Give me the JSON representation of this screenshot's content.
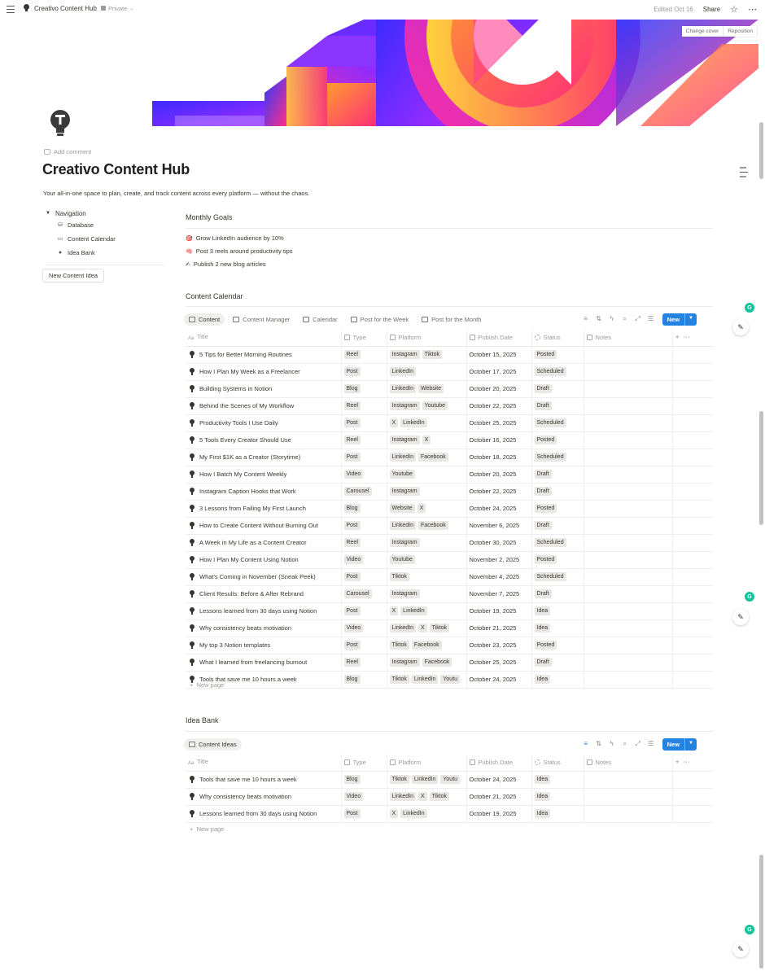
{
  "topbar": {
    "page_title": "Creativo Content Hub",
    "privacy": "Private",
    "edited": "Edited Oct 16",
    "share": "Share"
  },
  "cover": {
    "change_cover": "Change cover",
    "reposition": "Reposition",
    "colors": [
      "#4b2bff",
      "#9b27ff",
      "#ff2d6b",
      "#ffb02e",
      "#ff4fa3"
    ]
  },
  "page": {
    "add_comment": "Add comment",
    "title": "Creativo Content Hub",
    "subtitle": "Your all-in-one space to plan, create, and track content across every platform — without the chaos."
  },
  "nav": {
    "heading": "Navigation",
    "items": [
      {
        "label": "Database",
        "icon": "database-icon"
      },
      {
        "label": "Content Calendar",
        "icon": "calendar-icon"
      },
      {
        "label": "Idea Bank",
        "icon": "lightbulb-icon"
      }
    ],
    "new_idea_button": "New Content Idea"
  },
  "goals": {
    "title": "Monthly Goals",
    "items": [
      {
        "icon": "🎯",
        "text": "Grow LinkedIn audience by 10%"
      },
      {
        "icon": "🧠",
        "text": "Post 3 reels around productivity tips"
      },
      {
        "icon": "✍",
        "text": "Publish 2 new blog articles"
      }
    ]
  },
  "calendar": {
    "title": "Content Calendar",
    "tabs": [
      "Content",
      "Content Manager",
      "Calendar",
      "Post for the Week",
      "Post for the Month"
    ],
    "new_label": "New",
    "columns": [
      "Title",
      "Type",
      "Platform",
      "Publish Date",
      "Status",
      "Notes"
    ],
    "rows": [
      {
        "title": "5 Tips for Better Morning Routines",
        "type": "Reel",
        "platforms": [
          "Instagram",
          "Tiktok"
        ],
        "date": "October 15, 2025",
        "status": "Posted"
      },
      {
        "title": "How I Plan My Week as a Freelancer",
        "type": "Post",
        "platforms": [
          "LinkedIn"
        ],
        "date": "October 17, 2025",
        "status": "Scheduled"
      },
      {
        "title": "Building Systems in Notion",
        "type": "Blog",
        "platforms": [
          "LinkedIn",
          "Website"
        ],
        "date": "October 20, 2025",
        "status": "Draft"
      },
      {
        "title": "Behind the Scenes of My Workflow",
        "type": "Reel",
        "platforms": [
          "Instagram",
          "Youtube"
        ],
        "date": "October 22, 2025",
        "status": "Draft"
      },
      {
        "title": "Productivity Tools I Use Daily",
        "type": "Post",
        "platforms": [
          "X",
          "LinkedIn"
        ],
        "date": "October 25, 2025",
        "status": "Scheduled"
      },
      {
        "title": "5 Tools Every Creator Should Use",
        "type": "Reel",
        "platforms": [
          "Instagram",
          "X"
        ],
        "date": "October 16, 2025",
        "status": "Posted"
      },
      {
        "title": "My First $1K as a Creator (Storytime)",
        "type": "Post",
        "platforms": [
          "LinkedIn",
          "Facebook"
        ],
        "date": "October 18, 2025",
        "status": "Scheduled"
      },
      {
        "title": "How I Batch My Content Weekly",
        "type": "Video",
        "platforms": [
          "Youtube"
        ],
        "date": "October 20, 2025",
        "status": "Draft"
      },
      {
        "title": "Instagram Caption Hooks that Work",
        "type": "Carousel",
        "platforms": [
          "Instagram"
        ],
        "date": "October 22, 2025",
        "status": "Draft"
      },
      {
        "title": "3 Lessons from Failing My First Launch",
        "type": "Blog",
        "platforms": [
          "Website",
          "X"
        ],
        "date": "October 24, 2025",
        "status": "Posted"
      },
      {
        "title": "How to Create Content Without Burning Out",
        "type": "Post",
        "platforms": [
          "LinkedIn",
          "Facebook"
        ],
        "date": "November 6, 2025",
        "status": "Draft"
      },
      {
        "title": "A Week in My Life as a Content Creator",
        "type": "Reel",
        "platforms": [
          "Instagram"
        ],
        "date": "October 30, 2025",
        "status": "Scheduled"
      },
      {
        "title": "How I Plan My Content Using Notion",
        "type": "Video",
        "platforms": [
          "Youtube"
        ],
        "date": "November 2, 2025",
        "status": "Posted"
      },
      {
        "title": "What's Coming in November (Sneak Peek)",
        "type": "Post",
        "platforms": [
          "Tiktok"
        ],
        "date": "November 4, 2025",
        "status": "Scheduled"
      },
      {
        "title": "Client Results: Before & After Rebrand",
        "type": "Carousel",
        "platforms": [
          "Instagram"
        ],
        "date": "November 7, 2025",
        "status": "Draft"
      },
      {
        "title": "Lessons learned from 30 days using Notion",
        "type": "Post",
        "platforms": [
          "X",
          "LinkedIn"
        ],
        "date": "October 19, 2025",
        "status": "Idea"
      },
      {
        "title": "Why consistency beats motivation",
        "type": "Video",
        "platforms": [
          "LinkedIn",
          "X",
          "Tiktok"
        ],
        "date": "October 21, 2025",
        "status": "Idea"
      },
      {
        "title": "My top 3 Notion templates",
        "type": "Post",
        "platforms": [
          "Tiktok",
          "Facebook"
        ],
        "date": "October 23, 2025",
        "status": "Posted"
      },
      {
        "title": "What I learned from freelancing burnout",
        "type": "Reel",
        "platforms": [
          "Instagram",
          "Facebook"
        ],
        "date": "October 25, 2025",
        "status": "Draft"
      },
      {
        "title": "Tools that save me 10 hours a week",
        "type": "Blog",
        "platforms": [
          "Tiktok",
          "LinkedIn",
          "Youtu"
        ],
        "date": "October 24, 2025",
        "status": "Idea"
      }
    ],
    "new_page": "New page"
  },
  "idea_bank": {
    "title": "Idea Bank",
    "tab": "Content Ideas",
    "new_label": "New",
    "columns": [
      "Title",
      "Type",
      "Platform",
      "Publish Date",
      "Status",
      "Notes"
    ],
    "rows": [
      {
        "title": "Tools that save me 10 hours a week",
        "type": "Blog",
        "platforms": [
          "Tiktok",
          "LinkedIn",
          "Youtu"
        ],
        "date": "October 24, 2025",
        "status": "Idea"
      },
      {
        "title": "Why consistency beats motivation",
        "type": "Video",
        "platforms": [
          "LinkedIn",
          "X",
          "Tiktok"
        ],
        "date": "October 21, 2025",
        "status": "Idea"
      },
      {
        "title": "Lessons learned from 30 days using Notion",
        "type": "Post",
        "platforms": [
          "X",
          "LinkedIn"
        ],
        "date": "October 19, 2025",
        "status": "Idea"
      }
    ],
    "new_page": "New page"
  }
}
